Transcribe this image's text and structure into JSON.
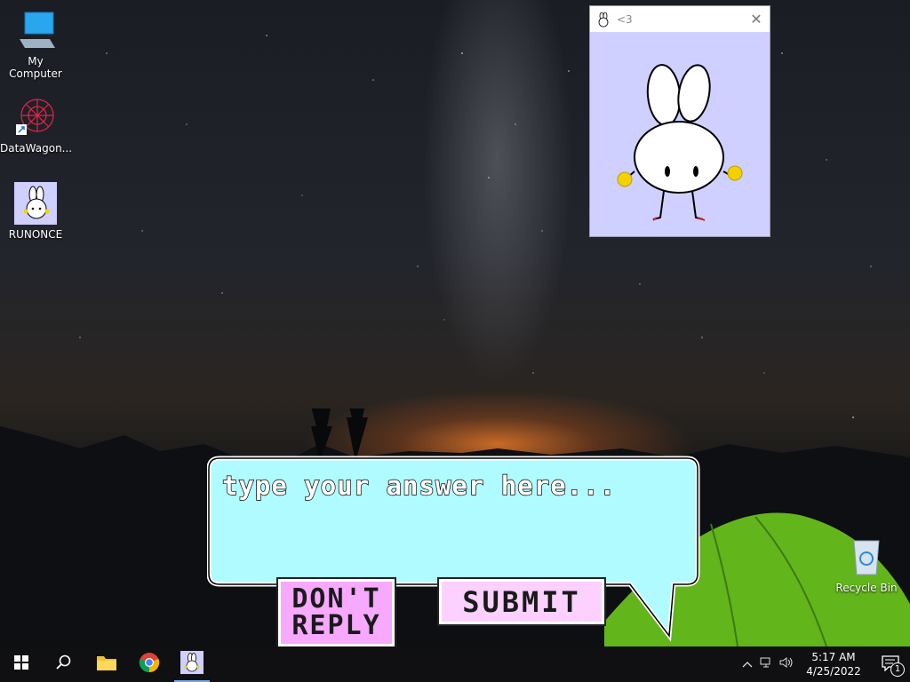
{
  "desktop": {
    "icons": [
      {
        "label": "My Computer",
        "icon": "monitor-icon"
      },
      {
        "label": "DataWagon...",
        "icon": "datawagon-icon"
      },
      {
        "label": "RUNONCE",
        "icon": "bunny-icon"
      },
      {
        "label": "Recycle Bin",
        "icon": "recycle-bin-icon"
      }
    ]
  },
  "bunny_window": {
    "title": "<3",
    "close_glyph": "✕",
    "background": "#cfd0ff"
  },
  "dialog": {
    "input_placeholder": "type your answer here...",
    "input_value": "",
    "dont_reply_label_line1": "DON'T",
    "dont_reply_label_line2": "REPLY",
    "submit_label": "SUBMIT",
    "bubble_color": "#b0fbff",
    "dont_reply_color": "#f7a8ff",
    "submit_color": "#fcd0ff"
  },
  "taskbar": {
    "items": [
      "start-icon",
      "search-icon",
      "file-explorer-icon",
      "chrome-icon",
      "bunny-app-icon"
    ],
    "tray": {
      "time": "5:17 AM",
      "date": "4/25/2022",
      "notification_count": "1"
    }
  }
}
